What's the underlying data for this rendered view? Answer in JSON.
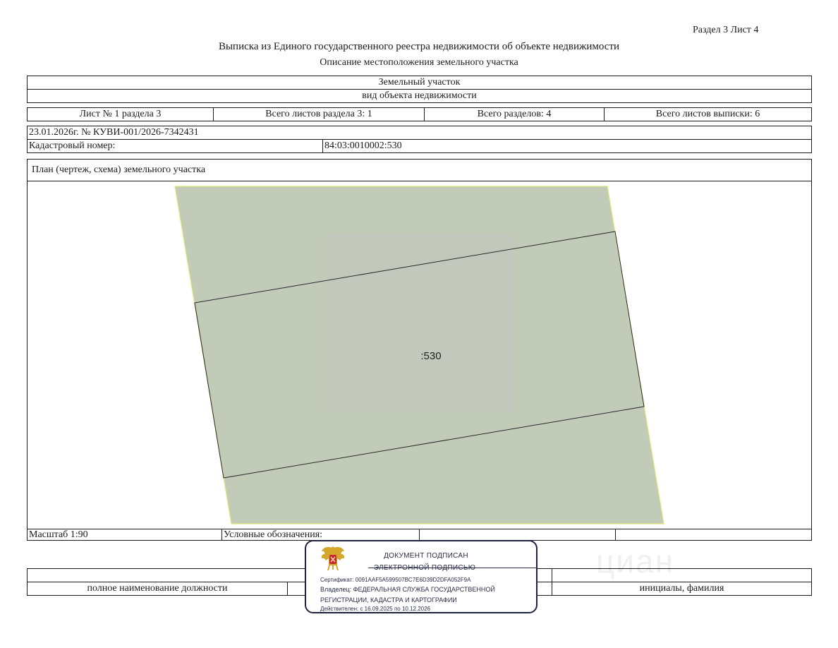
{
  "header": {
    "section_sheet": "Раздел 3    Лист 4",
    "title": "Выписка из Единого государственного реестра недвижимости об объекте недвижимости",
    "subtitle": "Описание местоположения земельного участка"
  },
  "object": {
    "type": "Земельный участок",
    "type_caption": "вид объекта недвижимости"
  },
  "sheet_info": {
    "sheet_of_section": "Лист № 1 раздела 3",
    "total_sheets_section": "Всего листов раздела 3: 1",
    "total_sections": "Всего разделов: 4",
    "total_sheets_extract": "Всего листов выписки: 6"
  },
  "record": {
    "date_number": "23.01.2026г. № КУВИ-001/2026-7342431",
    "cadastral_label": "Кадастровый номер:",
    "cadastral_number": "84:03:0010002:530"
  },
  "plan": {
    "title": "План (чертеж, схема) земельного участка",
    "parcel_label": ":530",
    "colors": {
      "fill": "#c1cbb8",
      "inner_fill": "#c3c7bc",
      "border_outline": "#dde77a",
      "parcel_line": "#2a2a2a"
    }
  },
  "footer": {
    "scale": "Масштаб 1:90",
    "legend_label": "Условные обозначения:",
    "position_caption": "полное наименование должности",
    "name_caption": "инициалы, фамилия"
  },
  "signature_stamp": {
    "line1": "ДОКУМЕНТ ПОДПИСАН",
    "line2": "ЭЛЕКТРОННОЙ ПОДПИСЬЮ",
    "certificate": "Сертификат: 0091AAF5A599507BC7E6D39D2DFA052F9A",
    "owner_line1": "Владелец: ФЕДЕРАЛЬНАЯ СЛУЖБА ГОСУДАРСТВЕННОЙ",
    "owner_line2": "РЕГИСТРАЦИИ, КАДАСТРА И КАРТОГРАФИИ",
    "valid": "Действителен: с 16.09.2025 по 10.12.2026",
    "emblem_icon": "double-headed-eagle-emblem-icon",
    "border_color": "#1f2340",
    "emblem_shield_color": "#c8262b",
    "emblem_gold_color": "#d4a72c"
  },
  "watermark": {
    "text": "циан"
  }
}
